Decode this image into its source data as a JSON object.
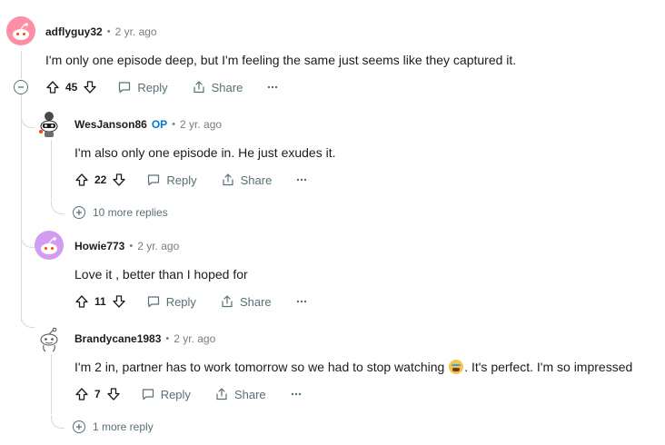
{
  "comments": [
    {
      "author": "adflyguy32",
      "age": "2 yr. ago",
      "text": "I'm only one episode deep, but I'm feeling the same just seems like they captured it.",
      "score": "45",
      "reply_label": "Reply",
      "share_label": "Share"
    },
    {
      "author": "WesJanson86",
      "op_badge": "OP",
      "age": "2 yr. ago",
      "text": "I'm also only one episode in. He just exudes it.",
      "score": "22",
      "reply_label": "Reply",
      "share_label": "Share",
      "more_replies": "10 more replies"
    },
    {
      "author": "Howie773",
      "age": "2 yr. ago",
      "text": "Love it , better than I hoped for",
      "score": "11",
      "reply_label": "Reply",
      "share_label": "Share"
    },
    {
      "author": "Brandycane1983",
      "age": "2 yr. ago",
      "text_before_emoji": "I'm 2 in, partner has to work tomorrow so we had to stop watching ",
      "text_after_emoji": ". It's perfect. I'm so impressed",
      "emoji_icon": "crying-face-emoji",
      "score": "7",
      "reply_label": "Reply",
      "share_label": "Share",
      "more_replies": "1 more reply"
    }
  ],
  "separator": "•",
  "colors": {
    "text": "#1c1c1c",
    "muted": "#576f76",
    "op_blue": "#0079d3",
    "thread_line": "#d7dadc"
  }
}
